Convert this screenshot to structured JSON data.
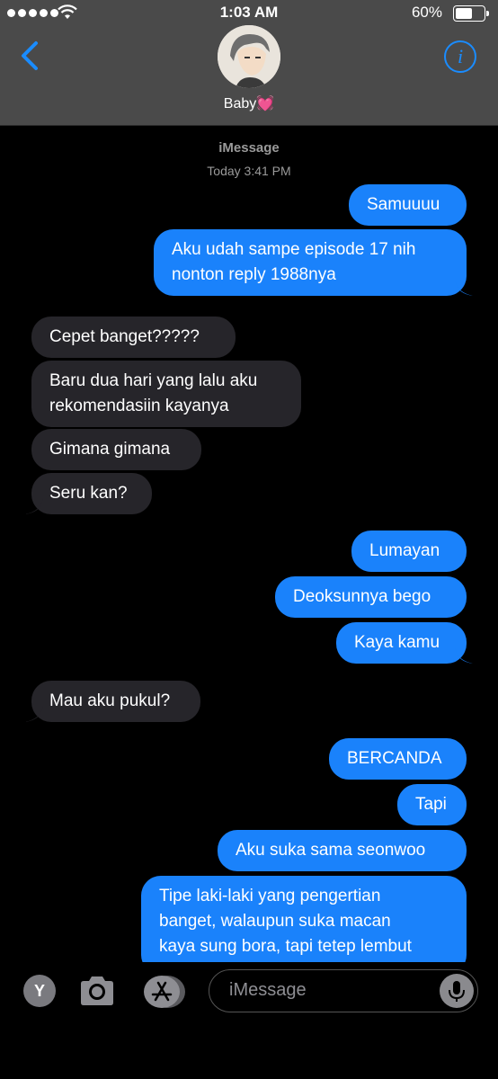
{
  "status": {
    "time": "1:03 AM",
    "battery": "60%"
  },
  "header": {
    "contact_name": "Baby",
    "heart": "💓",
    "info": "i"
  },
  "meta": {
    "service": "iMessage",
    "timestamp": "Today 3:41 PM"
  },
  "messages": [
    {
      "dir": "sent",
      "lines": [
        "Samuuuu"
      ]
    },
    {
      "dir": "sent",
      "lines": [
        "Aku udah sampe episode 17 nih",
        "nonton reply 1988nya"
      ]
    },
    {
      "dir": "recv",
      "lines": [
        "Cepet banget?????"
      ]
    },
    {
      "dir": "recv",
      "lines": [
        "Baru dua hari yang lalu aku",
        "rekomendasiin kayanya"
      ]
    },
    {
      "dir": "recv",
      "lines": [
        "Gimana gimana"
      ]
    },
    {
      "dir": "recv",
      "lines": [
        "Seru kan?"
      ]
    },
    {
      "dir": "sent",
      "lines": [
        "Lumayan"
      ]
    },
    {
      "dir": "sent",
      "lines": [
        "Deoksunnya bego"
      ]
    },
    {
      "dir": "sent",
      "lines": [
        "Kaya kamu"
      ]
    },
    {
      "dir": "recv",
      "lines": [
        "Mau aku pukul?"
      ]
    },
    {
      "dir": "sent",
      "lines": [
        "BERCANDA"
      ]
    },
    {
      "dir": "sent",
      "lines": [
        "Tapi"
      ]
    },
    {
      "dir": "sent",
      "lines": [
        "Aku suka sama seonwoo"
      ]
    },
    {
      "dir": "sent",
      "lines": [
        "Tipe laki-laki yang pengertian",
        "banget, walaupun suka macan",
        "kaya sung bora, tapi tetep lembut"
      ]
    }
  ],
  "composer": {
    "placeholder": "iMessage",
    "y_label": "Y"
  },
  "colors": {
    "sent": "#1a82fb",
    "received": "#26252a",
    "accent": "#1a8cff"
  },
  "icons": [
    "back-chevron-icon",
    "info-icon",
    "camera-icon",
    "app-store-icon",
    "microphone-icon",
    "wifi-icon",
    "battery-icon"
  ]
}
